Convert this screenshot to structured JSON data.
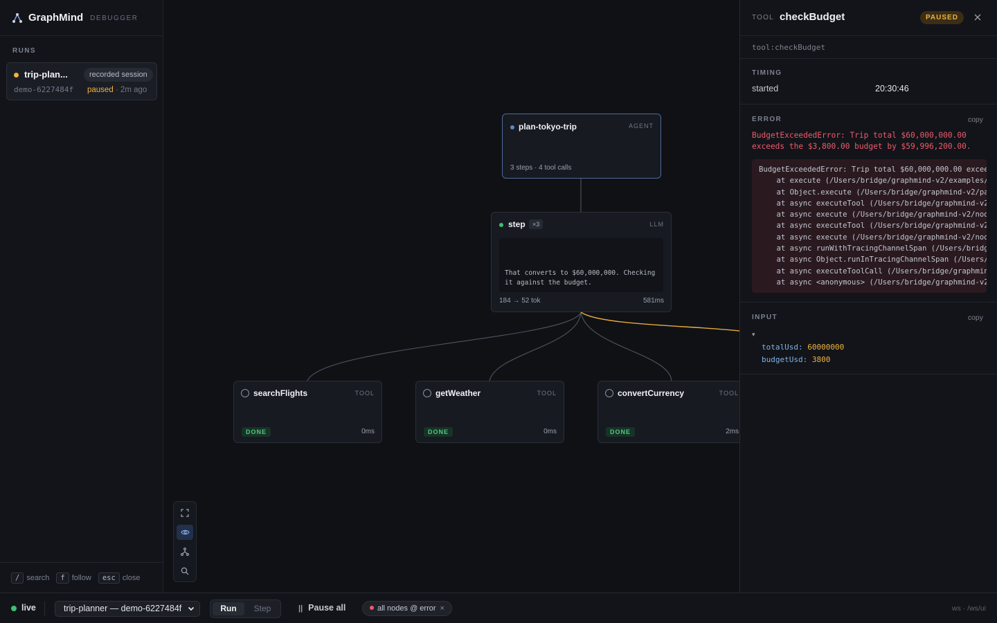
{
  "app": {
    "name": "GraphMind",
    "subtitle": "DEBUGGER"
  },
  "sidebar": {
    "runs_label": "RUNS",
    "run": {
      "title": "trip-plan...",
      "badge": "recorded session",
      "id": "demo-6227484f",
      "status": "paused",
      "ago": "· 2m ago",
      "status_color": "#f0b340"
    },
    "shortcuts": [
      {
        "key": "/",
        "label": "search"
      },
      {
        "key": "f",
        "label": "follow"
      },
      {
        "key": "esc",
        "label": "close"
      }
    ]
  },
  "graph": {
    "agent": {
      "title": "plan-tokyo-trip",
      "kind": "AGENT",
      "meta": "3 steps · 4 tool calls"
    },
    "step": {
      "title": "step",
      "count": "×3",
      "kind": "LLM",
      "output": "That converts to $60,000,000. Checking it against the budget.",
      "tokens": "184 → 52 tok",
      "duration": "581ms"
    },
    "tools": [
      {
        "title": "searchFlights",
        "kind": "TOOL",
        "status": "DONE",
        "duration": "0ms"
      },
      {
        "title": "getWeather",
        "kind": "TOOL",
        "status": "DONE",
        "duration": "0ms"
      },
      {
        "title": "convertCurrency",
        "kind": "TOOL",
        "status": "DONE",
        "duration": "2ms"
      }
    ],
    "colors": {
      "agent_border": "#4e6a9c",
      "active_edge": "#e8a93a",
      "done": "#4fc983"
    }
  },
  "canvas_tools": [
    "fit-view-icon",
    "eye-icon",
    "layout-tree-icon",
    "search-icon"
  ],
  "panel": {
    "kind": "TOOL",
    "title": "checkBudget",
    "state": "PAUSED",
    "path": "tool:checkBudget",
    "timing": {
      "label": "TIMING",
      "key": "started",
      "value": "20:30:46"
    },
    "error": {
      "label": "ERROR",
      "copy": "copy",
      "message": "BudgetExceededError: Trip total $60,000,000.00 exceeds the $3,800.00 budget by $59,996,200.00.",
      "stack": [
        "BudgetExceededError: Trip total $60,000,000.00 excee",
        "    at execute (/Users/bridge/graphmind-v2/examples/",
        "    at Object.execute (/Users/bridge/graphmind-v2/pa",
        "    at async executeTool (/Users/bridge/graphmind-v2",
        "    at async execute (/Users/bridge/graphmind-v2/nod",
        "    at async executeTool (/Users/bridge/graphmind-v2",
        "    at async execute (/Users/bridge/graphmind-v2/nod",
        "    at async runWithTracingChannelSpan (/Users/bridg",
        "    at async Object.runInTracingChannelSpan (/Users/",
        "    at async executeToolCall (/Users/bridge/graphmin",
        "    at async <anonymous> (/Users/bridge/graphmind-v2"
      ]
    },
    "input": {
      "label": "INPUT",
      "copy": "copy",
      "caret": "▾",
      "fields": [
        {
          "key": "totalUsd:",
          "value": "60000000"
        },
        {
          "key": "budgetUsd:",
          "value": "3800"
        }
      ]
    }
  },
  "bottom": {
    "live": "live",
    "run_select": "trip-planner — demo-6227484f",
    "run_button": "Run",
    "step_button": "Step",
    "pause_all": "Pause all",
    "filter": "all nodes @ error",
    "filter_close": "×",
    "ws": "ws · /ws/ui"
  }
}
